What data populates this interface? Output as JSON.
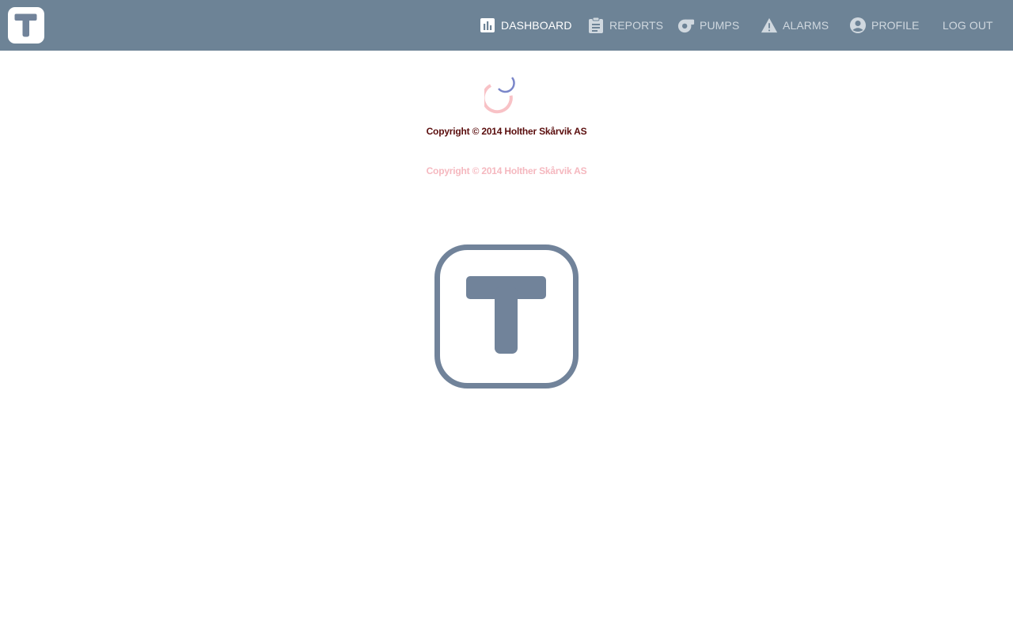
{
  "header": {
    "logo_icon": "t-logo-icon",
    "nav": [
      {
        "label": "DASHBOARD",
        "icon": "bar-chart-icon",
        "active": true
      },
      {
        "label": "REPORTS",
        "icon": "clipboard-icon",
        "active": false
      },
      {
        "label": "PUMPS",
        "icon": "pump-icon",
        "active": false
      },
      {
        "label": "ALARMS",
        "icon": "warning-icon",
        "active": false
      },
      {
        "label": "PROFILE",
        "icon": "account-circle-icon",
        "active": false
      },
      {
        "label": "LOG OUT",
        "icon": "",
        "active": false
      }
    ]
  },
  "main": {
    "spinner_icon": "loading-spinner-icon",
    "copyright_primary": "Copyright © 2014 Holther Skårvik AS",
    "copyright_faded": "Copyright © 2014 Holther Skårvik AS",
    "splash_logo_icon": "t-logo-icon"
  },
  "colors": {
    "topbar": "#6d8396",
    "logo": "#71839a",
    "nav_text": "#d0d8df",
    "nav_active": "#ffffff",
    "copyright_dark": "#5a0d0d",
    "copyright_faded": "#f5b8bf",
    "spinner_pink": "#f8c2c6",
    "spinner_blue": "#7a86c9"
  }
}
